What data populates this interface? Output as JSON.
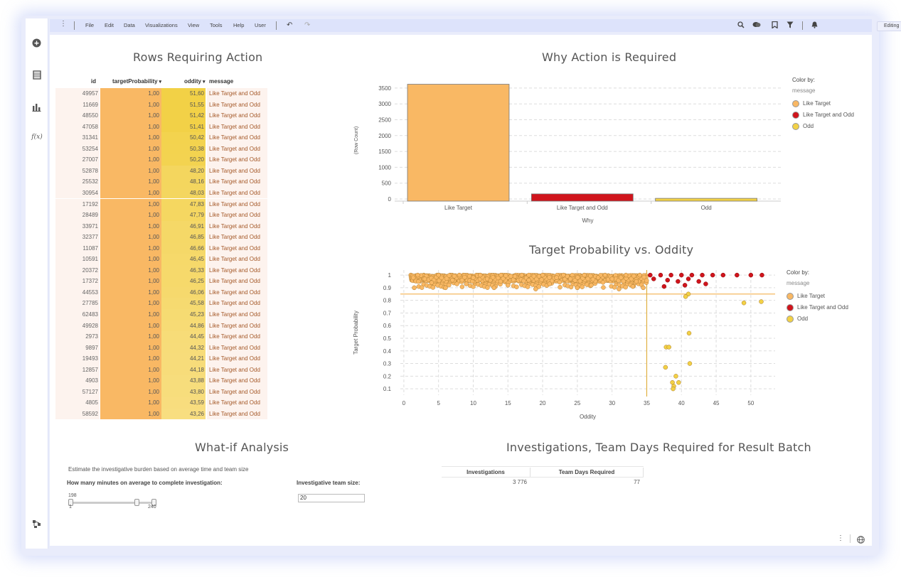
{
  "menubar": {
    "items": [
      "File",
      "Edit",
      "Data",
      "Visualizations",
      "View",
      "Tools",
      "Help",
      "User"
    ],
    "mode_select": "Editing"
  },
  "table": {
    "title": "Rows Requiring Action",
    "headers": [
      "id",
      "targetProbability",
      "oddity",
      "message"
    ],
    "rows": [
      [
        "49957",
        "1,00",
        "51,60",
        "Like Target and Odd"
      ],
      [
        "11669",
        "1,00",
        "51,55",
        "Like Target and Odd"
      ],
      [
        "48550",
        "1,00",
        "51,42",
        "Like Target and Odd"
      ],
      [
        "47058",
        "1,00",
        "51,41",
        "Like Target and Odd"
      ],
      [
        "31341",
        "1,00",
        "50,42",
        "Like Target and Odd"
      ],
      [
        "53254",
        "1,00",
        "50,38",
        "Like Target and Odd"
      ],
      [
        "27007",
        "1,00",
        "50,20",
        "Like Target and Odd"
      ],
      [
        "52878",
        "1,00",
        "48,20",
        "Like Target and Odd"
      ],
      [
        "25532",
        "1,00",
        "48,16",
        "Like Target and Odd"
      ],
      [
        "30954",
        "1,00",
        "48,03",
        "Like Target and Odd"
      ],
      [
        "17192",
        "1,00",
        "47,83",
        "Like Target and Odd"
      ],
      [
        "28489",
        "1,00",
        "47,79",
        "Like Target and Odd"
      ],
      [
        "33971",
        "1,00",
        "46,91",
        "Like Target and Odd"
      ],
      [
        "32377",
        "1,00",
        "46,85",
        "Like Target and Odd"
      ],
      [
        "11087",
        "1,00",
        "46,66",
        "Like Target and Odd"
      ],
      [
        "10591",
        "1,00",
        "46,45",
        "Like Target and Odd"
      ],
      [
        "20372",
        "1,00",
        "46,33",
        "Like Target and Odd"
      ],
      [
        "17372",
        "1,00",
        "46,25",
        "Like Target and Odd"
      ],
      [
        "44553",
        "1,00",
        "46,06",
        "Like Target and Odd"
      ],
      [
        "27785",
        "1,00",
        "45,58",
        "Like Target and Odd"
      ],
      [
        "62483",
        "1,00",
        "45,23",
        "Like Target and Odd"
      ],
      [
        "49928",
        "1,00",
        "44,86",
        "Like Target and Odd"
      ],
      [
        "2973",
        "1,00",
        "44,45",
        "Like Target and Odd"
      ],
      [
        "9897",
        "1,00",
        "44,32",
        "Like Target and Odd"
      ],
      [
        "19493",
        "1,00",
        "44,21",
        "Like Target and Odd"
      ],
      [
        "12857",
        "1,00",
        "44,18",
        "Like Target and Odd"
      ],
      [
        "4903",
        "1,00",
        "43,88",
        "Like Target and Odd"
      ],
      [
        "57127",
        "1,00",
        "43,80",
        "Like Target and Odd"
      ],
      [
        "4805",
        "1,00",
        "43,59",
        "Like Target and Odd"
      ],
      [
        "58592",
        "1,00",
        "43,26",
        "Like Target and Odd"
      ]
    ]
  },
  "bar_chart": {
    "title": "Why Action is Required",
    "legend_title": "Color by:",
    "legend_sub": "message",
    "legend": [
      "Like Target",
      "Like Target and Odd",
      "Odd"
    ]
  },
  "scatter_chart": {
    "title": "Target Probability vs. Oddity",
    "legend_title": "Color by:",
    "legend_sub": "message",
    "legend": [
      "Like Target",
      "Like Target and Odd",
      "Odd"
    ]
  },
  "colors": {
    "like_target": "#f9b864",
    "like_target_odd": "#d0141c",
    "odd": "#f2d146"
  },
  "chart_data": [
    {
      "type": "bar",
      "title": "Why Action is Required",
      "categories": [
        "Like Target",
        "Like Target and Odd",
        "Odd"
      ],
      "values": [
        3620,
        160,
        20
      ],
      "xlabel": "Why",
      "ylabel": "(Row Count)",
      "yticks": [
        0,
        500,
        1000,
        1500,
        2000,
        2500,
        3000,
        3500
      ],
      "ylim": [
        0,
        3700
      ]
    },
    {
      "type": "scatter",
      "title": "Target Probability vs. Oddity",
      "xlabel": "Oddity",
      "ylabel": "Target Probability",
      "xticks": [
        0,
        5,
        10,
        15,
        20,
        25,
        30,
        35,
        40,
        45,
        50
      ],
      "yticks": [
        0.1,
        0.2,
        0.3,
        0.4,
        0.5,
        0.6,
        0.7,
        0.8,
        0.9,
        1
      ],
      "xlim": [
        -0.5,
        53.5
      ],
      "ylim": [
        0.05,
        1.04
      ],
      "thresholds": {
        "x": 35,
        "y": 0.85
      },
      "series": [
        {
          "name": "Like Target",
          "color": "#f9b864",
          "x": [
            2,
            5,
            8,
            11,
            14,
            17,
            20,
            23,
            26,
            29,
            32,
            34,
            3,
            7,
            12,
            18,
            24,
            30,
            4,
            9,
            15,
            21,
            27,
            33,
            1.5,
            6,
            13,
            19,
            25,
            31,
            34.5,
            10,
            16,
            22,
            28,
            33.5
          ],
          "y": [
            1,
            1,
            1,
            1,
            1,
            1,
            1,
            1,
            1,
            1,
            1,
            1,
            0.97,
            0.96,
            0.97,
            0.96,
            0.97,
            0.97,
            0.94,
            0.93,
            0.92,
            0.93,
            0.92,
            0.91,
            0.9,
            0.9,
            0.9,
            0.89,
            0.9,
            0.89,
            0.9,
            0.98,
            0.99,
            0.98,
            0.98,
            0.95
          ]
        },
        {
          "name": "Like Target and Odd",
          "color": "#d0141c",
          "x": [
            35.5,
            37,
            38.5,
            40,
            41.5,
            43,
            44.5,
            46,
            48,
            50,
            51.6,
            36,
            38,
            39.5,
            41,
            42.5,
            37.5,
            40.5,
            43.5
          ],
          "y": [
            1,
            1,
            1,
            1,
            1,
            1,
            1,
            1,
            1,
            1,
            1,
            0.97,
            0.96,
            0.95,
            0.97,
            0.95,
            0.91,
            0.92,
            0.93
          ]
        },
        {
          "name": "Odd",
          "color": "#f2d146",
          "x": [
            41,
            40.6,
            49,
            51.5,
            41.1,
            37.8,
            38.2,
            41.2,
            37.7,
            39.2,
            38.7,
            38.9,
            39.6,
            38.8
          ],
          "y": [
            0.85,
            0.83,
            0.78,
            0.79,
            0.54,
            0.43,
            0.43,
            0.3,
            0.27,
            0.2,
            0.15,
            0.12,
            0.15,
            0.1
          ]
        }
      ]
    }
  ],
  "whatif": {
    "title": "What-if Analysis",
    "description": "Estimate the investigative burden based on average time and team size",
    "minutes_label": "How many minutes on average to complete investigation:",
    "minutes_value": "198",
    "minutes_value_num": 198,
    "slider_min": "1",
    "slider_max": "240",
    "team_label": "Investigative team size:",
    "team_value": "20"
  },
  "investigations": {
    "title": "Investigations, Team Days Required for Result Batch",
    "headers": [
      "Investigations",
      "Team Days Required"
    ],
    "values": [
      "3 776",
      "77"
    ]
  }
}
